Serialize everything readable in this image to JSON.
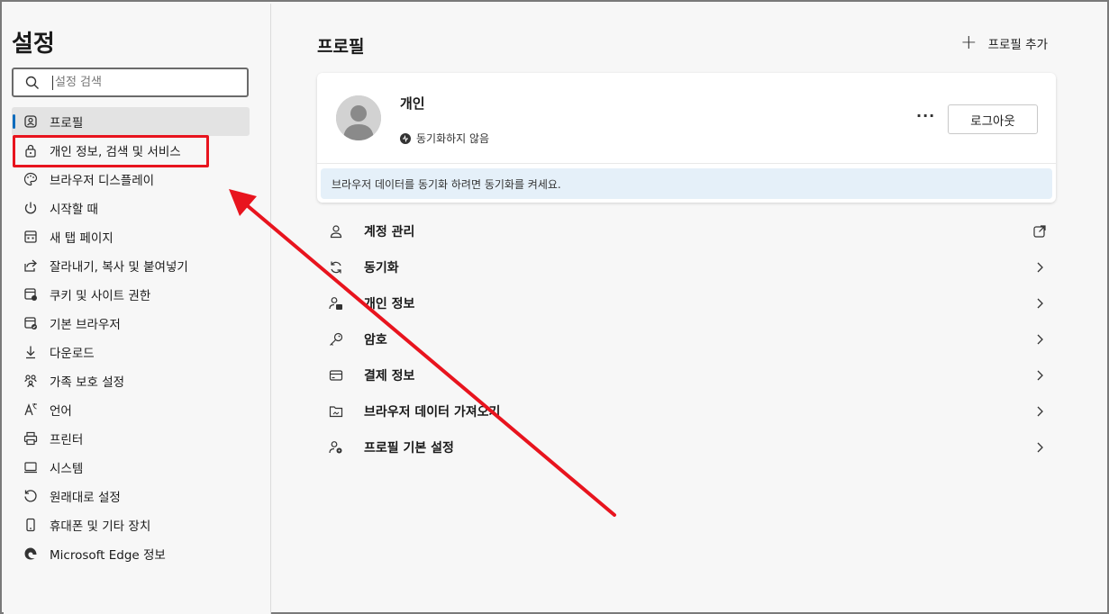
{
  "sidebar": {
    "title": "설정",
    "search_placeholder": "설정 검색",
    "items": [
      {
        "label": "프로필",
        "icon": "profile-icon"
      },
      {
        "label": "개인 정보, 검색 및 서비스",
        "icon": "lock-icon"
      },
      {
        "label": "브라우저 디스플레이",
        "icon": "palette-icon"
      },
      {
        "label": "시작할 때",
        "icon": "power-icon"
      },
      {
        "label": "새 탭 페이지",
        "icon": "grid-icon"
      },
      {
        "label": "잘라내기, 복사 및 붙여넣기",
        "icon": "share-icon"
      },
      {
        "label": "쿠키 및 사이트 권한",
        "icon": "site-permissions-icon"
      },
      {
        "label": "기본 브라우저",
        "icon": "default-browser-icon"
      },
      {
        "label": "다운로드",
        "icon": "download-icon"
      },
      {
        "label": "가족 보호 설정",
        "icon": "family-icon"
      },
      {
        "label": "언어",
        "icon": "language-icon"
      },
      {
        "label": "프린터",
        "icon": "printer-icon"
      },
      {
        "label": "시스템",
        "icon": "system-icon"
      },
      {
        "label": "원래대로 설정",
        "icon": "reset-icon"
      },
      {
        "label": "휴대폰 및 기타 장치",
        "icon": "phone-icon"
      },
      {
        "label": "Microsoft Edge 정보",
        "icon": "edge-icon"
      }
    ]
  },
  "main": {
    "title": "프로필",
    "add_profile_label": "프로필 추가",
    "profile": {
      "name": "개인",
      "sync_status": "동기화하지 않음",
      "more_label": "···",
      "logout_label": "로그아웃",
      "banner_text": "브라우저 데이터를 동기화 하려면 동기화를 켜세요."
    },
    "menu": [
      {
        "label": "계정 관리",
        "icon": "account-icon",
        "trail": "external-link-icon"
      },
      {
        "label": "동기화",
        "icon": "sync-icon",
        "trail": "chevron-right-icon"
      },
      {
        "label": "개인 정보",
        "icon": "personal-info-icon",
        "trail": "chevron-right-icon"
      },
      {
        "label": "암호",
        "icon": "key-icon",
        "trail": "chevron-right-icon"
      },
      {
        "label": "결제 정보",
        "icon": "card-icon",
        "trail": "chevron-right-icon"
      },
      {
        "label": "브라우저 데이터 가져오기",
        "icon": "import-icon",
        "trail": "chevron-right-icon"
      },
      {
        "label": "프로필 기본 설정",
        "icon": "profile-settings-icon",
        "trail": "chevron-right-icon"
      }
    ]
  },
  "annotation": {
    "highlight_color": "#e8141e",
    "arrow_color": "#e8141e"
  }
}
